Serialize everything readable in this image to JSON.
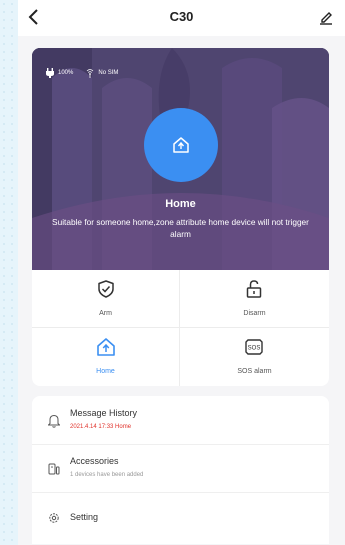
{
  "header": {
    "title": "C30",
    "back_icon": "chevron-left-icon",
    "edit_icon": "pencil-icon"
  },
  "hero": {
    "battery": "100%",
    "sim": "No SIM",
    "mode_title": "Home",
    "mode_description": "Suitable for someone home,zone attribute home device will not trigger alarm",
    "mode_icon": "home-shield-icon",
    "accent_color": "#3b8ff2",
    "background_color": "#5a4678"
  },
  "actions": [
    {
      "label": "Arm",
      "icon": "shield-check-icon",
      "active": false
    },
    {
      "label": "Disarm",
      "icon": "unlock-icon",
      "active": false
    },
    {
      "label": "Home",
      "icon": "home-shield-icon",
      "active": true
    },
    {
      "label": "SOS alarm",
      "icon": "sos-icon",
      "active": false
    }
  ],
  "menu": {
    "message_history": {
      "label": "Message History",
      "detail": "2021.4.14 17:33 Home",
      "icon": "bell-icon",
      "detail_color": "#e0322b"
    },
    "accessories": {
      "label": "Accessories",
      "detail": "1 devices have been added",
      "icon": "accessories-icon"
    },
    "setting": {
      "label": "Setting",
      "icon": "gear-icon"
    }
  }
}
